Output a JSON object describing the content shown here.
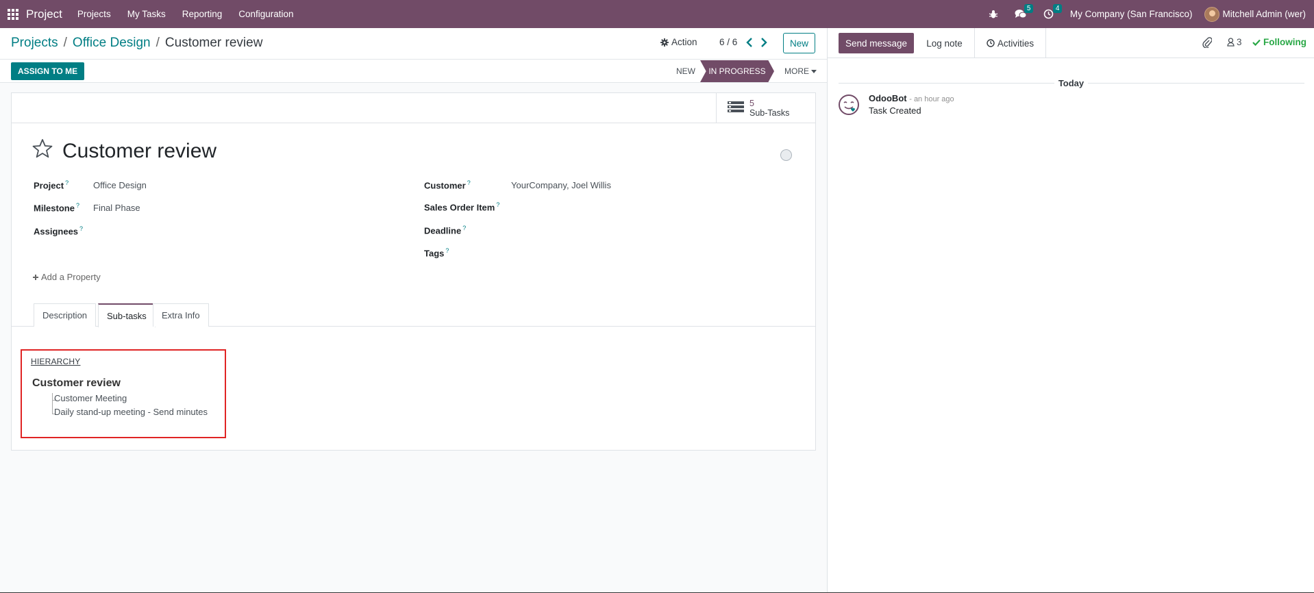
{
  "navbar": {
    "app_name": "Project",
    "menu": [
      "Projects",
      "My Tasks",
      "Reporting",
      "Configuration"
    ],
    "messages_count": "5",
    "activities_count": "4",
    "company": "My Company (San Francisco)",
    "user": "Mitchell Admin (wer)",
    "bg_color": "#714b67"
  },
  "breadcrumb": {
    "items": [
      "Projects",
      "Office Design"
    ],
    "current": "Customer review"
  },
  "control": {
    "action_label": "Action",
    "pager": "6 / 6",
    "new_label": "New"
  },
  "statusbar": {
    "assign_label": "ASSIGN TO ME",
    "stages": [
      "NEW",
      "IN PROGRESS"
    ],
    "current_stage": "IN PROGRESS",
    "more_label": "MORE"
  },
  "smart_button": {
    "count": "5",
    "label": "Sub-Tasks"
  },
  "task": {
    "title": "Customer review"
  },
  "fields": {
    "project_label": "Project",
    "project_value": "Office Design",
    "milestone_label": "Milestone",
    "milestone_value": "Final Phase",
    "assignees_label": "Assignees",
    "customer_label": "Customer",
    "customer_value": "YourCompany, Joel Willis",
    "sale_line_label": "Sales Order Item",
    "deadline_label": "Deadline",
    "tags_label": "Tags",
    "help_mark": "?"
  },
  "add_property_label": "Add a Property",
  "tabs": [
    "Description",
    "Sub-tasks",
    "Extra Info"
  ],
  "active_tab": "Sub-tasks",
  "hierarchy": {
    "title": "HIERARCHY",
    "root": "Customer review",
    "children": [
      "Customer Meeting",
      "Daily stand-up meeting - Send minutes"
    ]
  },
  "chatter": {
    "send_message": "Send message",
    "log_note": "Log note",
    "activities": "Activities",
    "followers_count": "3",
    "following": "Following",
    "date_separator": "Today",
    "message": {
      "author": "OdooBot",
      "date": "- an hour ago",
      "body": "Task Created"
    }
  },
  "colors": {
    "brand": "#714b67",
    "accent": "#017e84",
    "following": "#28a745",
    "highlight_box": "#e02424"
  }
}
